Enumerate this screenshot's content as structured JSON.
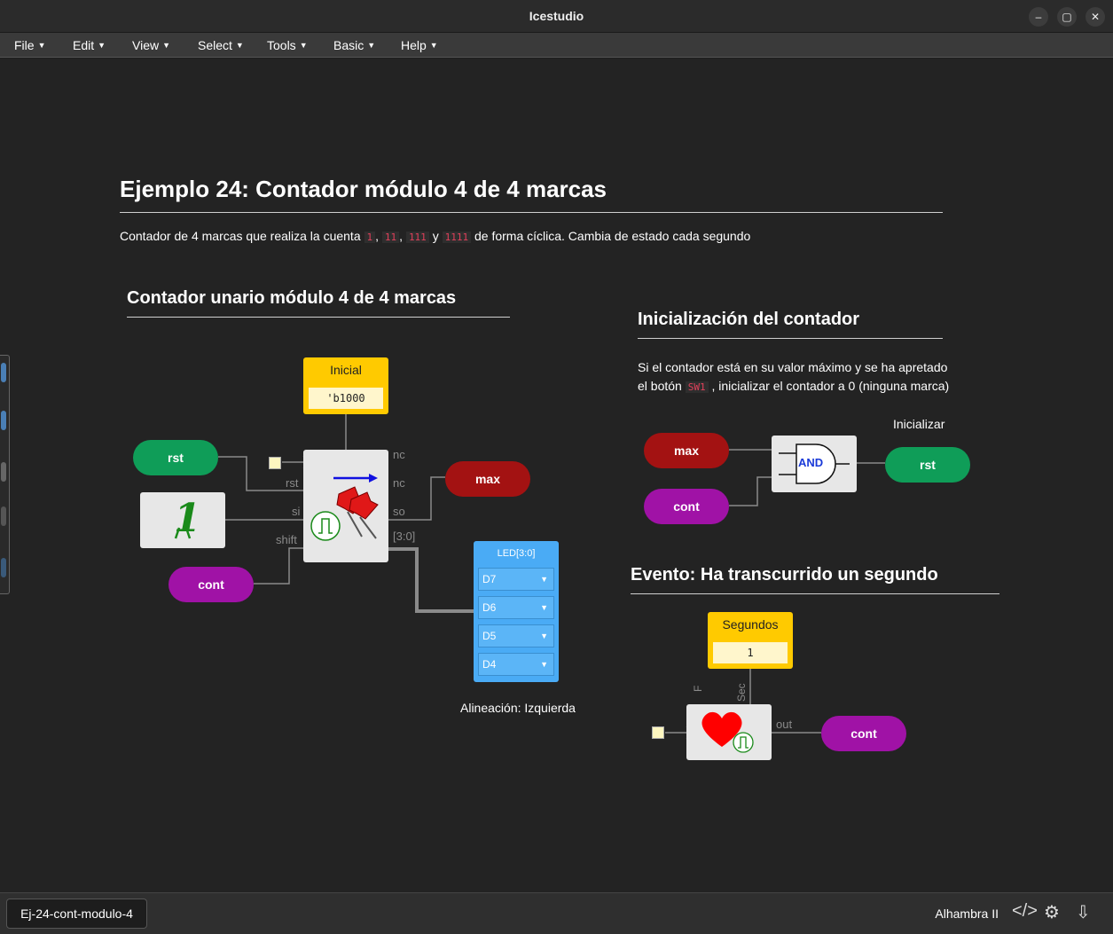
{
  "window": {
    "title": "Icestudio"
  },
  "menu": [
    "File",
    "Edit",
    "View",
    "Select",
    "Tools",
    "Basic",
    "Help"
  ],
  "doc": {
    "title": "Ejemplo 24: Contador módulo 4 de 4 marcas",
    "desc_before": "Contador de 4 marcas que realiza la cuenta",
    "codes": [
      "1",
      "11",
      "111",
      "1111"
    ],
    "sep1": ",",
    "sep2": ",",
    "sep_y": "y",
    "desc_after": "de forma cíclica. Cambia de estado cada segundo"
  },
  "section_left": {
    "title": "Contador unario módulo 4 de 4 marcas",
    "const_label": "Inicial",
    "const_value": "'b1000",
    "inputs": [
      "rst",
      "cont"
    ],
    "output": "max",
    "ports_in": [
      "rst",
      "si",
      "shift"
    ],
    "ports_out": [
      "nc",
      "nc",
      "so",
      "[3:0]"
    ],
    "led_title": "LED[3:0]",
    "led_rows": [
      "D7",
      "D6",
      "D5",
      "D4"
    ],
    "align_note": "Alineación: Izquierda"
  },
  "section_init": {
    "title": "Inicialización del contador",
    "text_line1": "Si el contador está en su valor máximo y se ha apretado",
    "text_line2_before": "el botón",
    "code": "SW1",
    "text_line2_after": ", inicializar el contador a 0 (ninguna marca)",
    "caption": "Inicializar",
    "inputs": [
      "max",
      "cont"
    ],
    "gate": "AND",
    "output": "rst"
  },
  "section_event": {
    "title": "Evento: Ha transcurrido un segundo",
    "const_label": "Segundos",
    "const_value": "1",
    "port_f": "F",
    "port_sec": "Sec",
    "port_out": "out",
    "output": "cont"
  },
  "status": {
    "project": "Ej-24-cont-modulo-4",
    "board": "Alhambra II"
  },
  "colors": {
    "green": "#0f9d58",
    "red": "#a31212",
    "purple": "#a012a6",
    "const": "#ffca00",
    "led": "#4aabf5"
  }
}
